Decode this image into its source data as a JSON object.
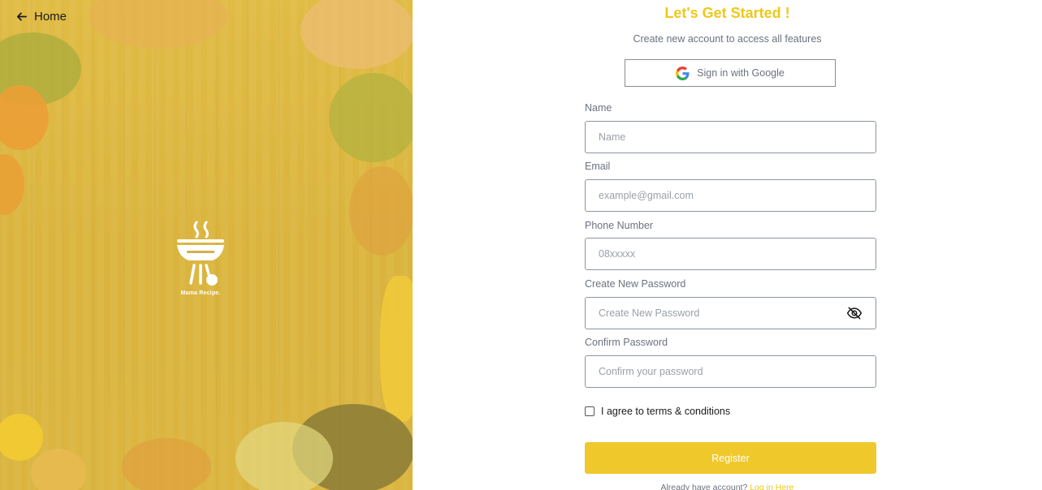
{
  "nav": {
    "home_label": "Home",
    "home_icon": "arrow-left-icon"
  },
  "logo": {
    "text": "Mama Recipe.",
    "icon": "grill-icon"
  },
  "header": {
    "title": "Let's Get Started !",
    "subtitle": "Create new account to access all features"
  },
  "google": {
    "label": "Sign in with Google",
    "icon": "google-icon"
  },
  "fields": {
    "name": {
      "label": "Name",
      "placeholder": "Name",
      "value": ""
    },
    "email": {
      "label": "Email",
      "placeholder": "example@gmail.com",
      "value": ""
    },
    "phone": {
      "label": "Phone Number",
      "placeholder": "08xxxxx",
      "value": ""
    },
    "password": {
      "label": "Create New Password",
      "placeholder": "Create New Password",
      "value": "",
      "toggle_icon": "eye-off-icon"
    },
    "confirm": {
      "label": "Confirm Password",
      "placeholder": "Confirm your password",
      "value": ""
    }
  },
  "terms": {
    "label": "I agree to terms & conditions",
    "checked": false
  },
  "register": {
    "label": "Register"
  },
  "login": {
    "prompt": "Already have account?",
    "link": "Log in Here"
  },
  "colors": {
    "accent": "#efc81a",
    "button": "#efc82c",
    "text_muted": "#6b7280"
  }
}
